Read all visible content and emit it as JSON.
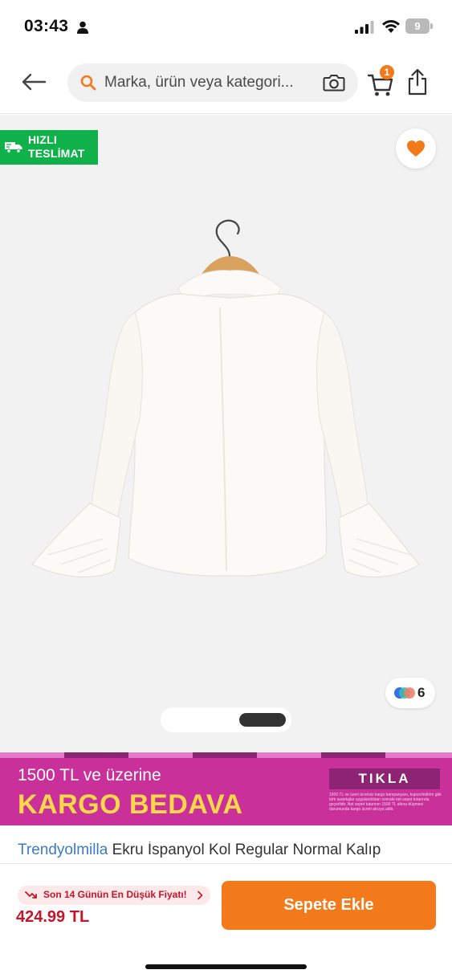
{
  "status_bar": {
    "time": "03:43",
    "battery_level": "9"
  },
  "header": {
    "search_placeholder": "Marka, ürün veya kategori...",
    "cart_count": "1"
  },
  "product_image": {
    "fast_delivery_line1": "HIZLI",
    "fast_delivery_line2": "TESLİMAT",
    "color_variant_count": "6",
    "pager": {
      "total": 2,
      "active": 2
    }
  },
  "promo_banner": {
    "line1": "1500 TL ve üzerine",
    "line2": "KARGO BEDAVA",
    "cta": "TIKLA",
    "fineprint": "1500 TL ve üzeri ücretsiz kargo kampanyası, kupon/indirim gibi tüm avantajlar uygulandıktan sonraki net sepet tutarında geçerlidir. Net sepet tutarının 1500 TL altına düşmesi durumunda kargo ücreti alıcıya aittir."
  },
  "product": {
    "brand": "Trendyolmilla",
    "title": "Ekru İspanyol Kol Regular Normal Kalıp"
  },
  "bottom_bar": {
    "lowest_price_label": "Son 14 Günün En Düşük Fiyatı!",
    "price": "424.99 TL",
    "add_to_cart_label": "Sepete Ekle"
  },
  "colors": {
    "accent_orange": "#f27a1a",
    "price_red": "#c4162a",
    "fast_delivery_green": "#10b14b",
    "promo_magenta": "#c9309a",
    "promo_yellow": "#ffd84a",
    "brand_blue": "#3b7bc4"
  }
}
